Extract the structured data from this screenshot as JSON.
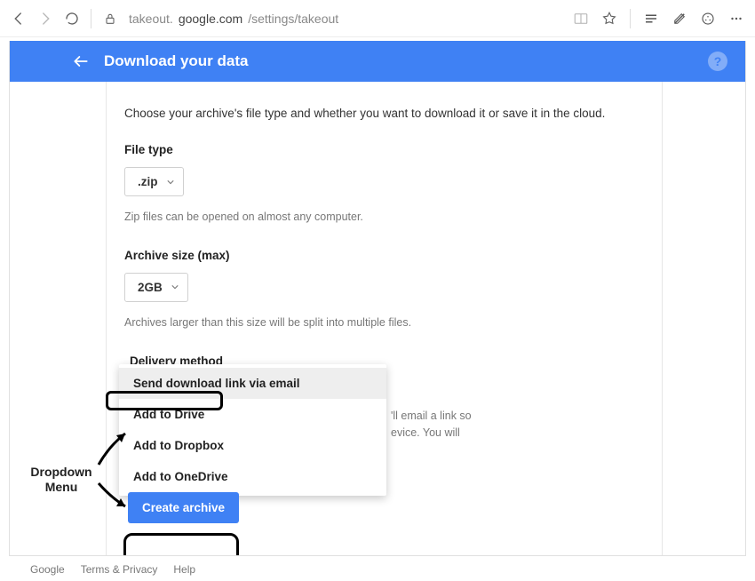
{
  "browser": {
    "url_host": "google.com",
    "url_prefix": "takeout.",
    "url_path": "/settings/takeout"
  },
  "header": {
    "title": "Download your data",
    "help": "?"
  },
  "intro": "Choose your archive's file type and whether you want to download it or save it in the cloud.",
  "file_type": {
    "label": "File type",
    "value": ".zip",
    "helper": "Zip files can be opened on almost any computer."
  },
  "archive_size": {
    "label": "Archive size (max)",
    "value": "2GB",
    "helper": "Archives larger than this size will be split into multiple files."
  },
  "delivery": {
    "label": "Delivery method",
    "options": [
      "Send download link via email",
      "Add to Drive",
      "Add to Dropbox",
      "Add to OneDrive"
    ],
    "visible_behind_text": "'ll email a link so evice. You will"
  },
  "button": {
    "create": "Create archive"
  },
  "annotation": {
    "label_line1": "Dropdown",
    "label_line2": "Menu"
  },
  "footer": [
    "Google",
    "Terms & Privacy",
    "Help"
  ]
}
